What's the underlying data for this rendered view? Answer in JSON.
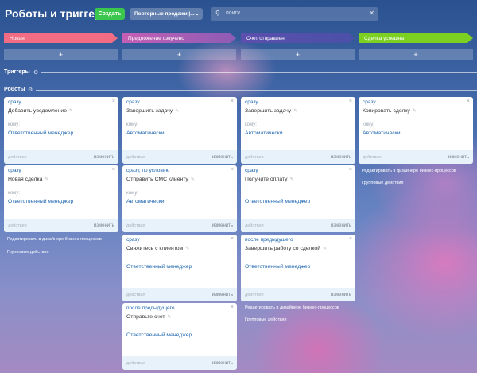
{
  "header": {
    "title": "Роботы и триггеры",
    "create_label": "Создать",
    "pipeline_label": "Повторные продажи |...",
    "pipeline_chevron": "⌄",
    "search_placeholder": "поиск",
    "search_icon": "⚲",
    "clear_icon": "✕"
  },
  "stages": [
    {
      "label": "Новая",
      "color": "#f26d84"
    },
    {
      "label": "Предложение озвучено",
      "color": "#c55fb5"
    },
    {
      "label": "Счет отправлен",
      "color": "#5c4fae"
    },
    {
      "label": "Сделка успешна",
      "color": "#7bd021"
    }
  ],
  "plus_label": "+",
  "sections": {
    "triggers": "Триггеры",
    "robots": "Роботы",
    "gear_icon": "⚙"
  },
  "column_links": {
    "designer": "Редактировать в дизайнере бизнес-процессов",
    "group": "Групповые действия"
  },
  "cards": [
    {
      "cond": "сразу",
      "name": "Добавить уведомление",
      "to": "кому:",
      "resp": "Ответственный менеджер",
      "act": "действия",
      "edit": "изменить"
    },
    {
      "cond": "сразу",
      "name": "Новая сделка",
      "to": "кому:",
      "resp": "Ответственный менеджер",
      "act": "действия",
      "edit": "изменить"
    },
    {
      "cond": "сразу",
      "name": "Завершить задачу",
      "to": "кому:",
      "resp": "Автоматически",
      "act": "действия",
      "edit": "изменить"
    },
    {
      "cond": "сразу, по условию",
      "name": "Отправить СМС клиенту",
      "to": "кому:",
      "resp": "Автоматически",
      "act": "действия",
      "edit": "изменить"
    },
    {
      "cond": "сразу",
      "name": "Свяжитесь с клиентом",
      "to": "",
      "resp": "Ответственный менеджер",
      "act": "действия",
      "edit": "изменить"
    },
    {
      "cond": "после предыдущего",
      "name": "Отправьте счет",
      "to": "",
      "resp": "Ответственный менеджер",
      "act": "действия",
      "edit": "изменить"
    },
    {
      "cond": "сразу",
      "name": "Завершить задачу",
      "to": "кому:",
      "resp": "Автоматически",
      "act": "действия",
      "edit": "изменить"
    },
    {
      "cond": "сразу",
      "name": "Получите оплату",
      "to": "",
      "resp": "Ответственный менеджер",
      "act": "действия",
      "edit": "изменить"
    },
    {
      "cond": "после предыдущего",
      "name": "Завершить работу со сделкой",
      "to": "",
      "resp": "Ответственный менеджер",
      "act": "действия",
      "edit": "изменить"
    },
    {
      "cond": "сразу",
      "name": "Копировать сделку",
      "to": "кому:",
      "resp": "Автоматически",
      "act": "действия",
      "edit": "изменить"
    }
  ],
  "icons": {
    "close": "×",
    "pencil": "✎"
  }
}
